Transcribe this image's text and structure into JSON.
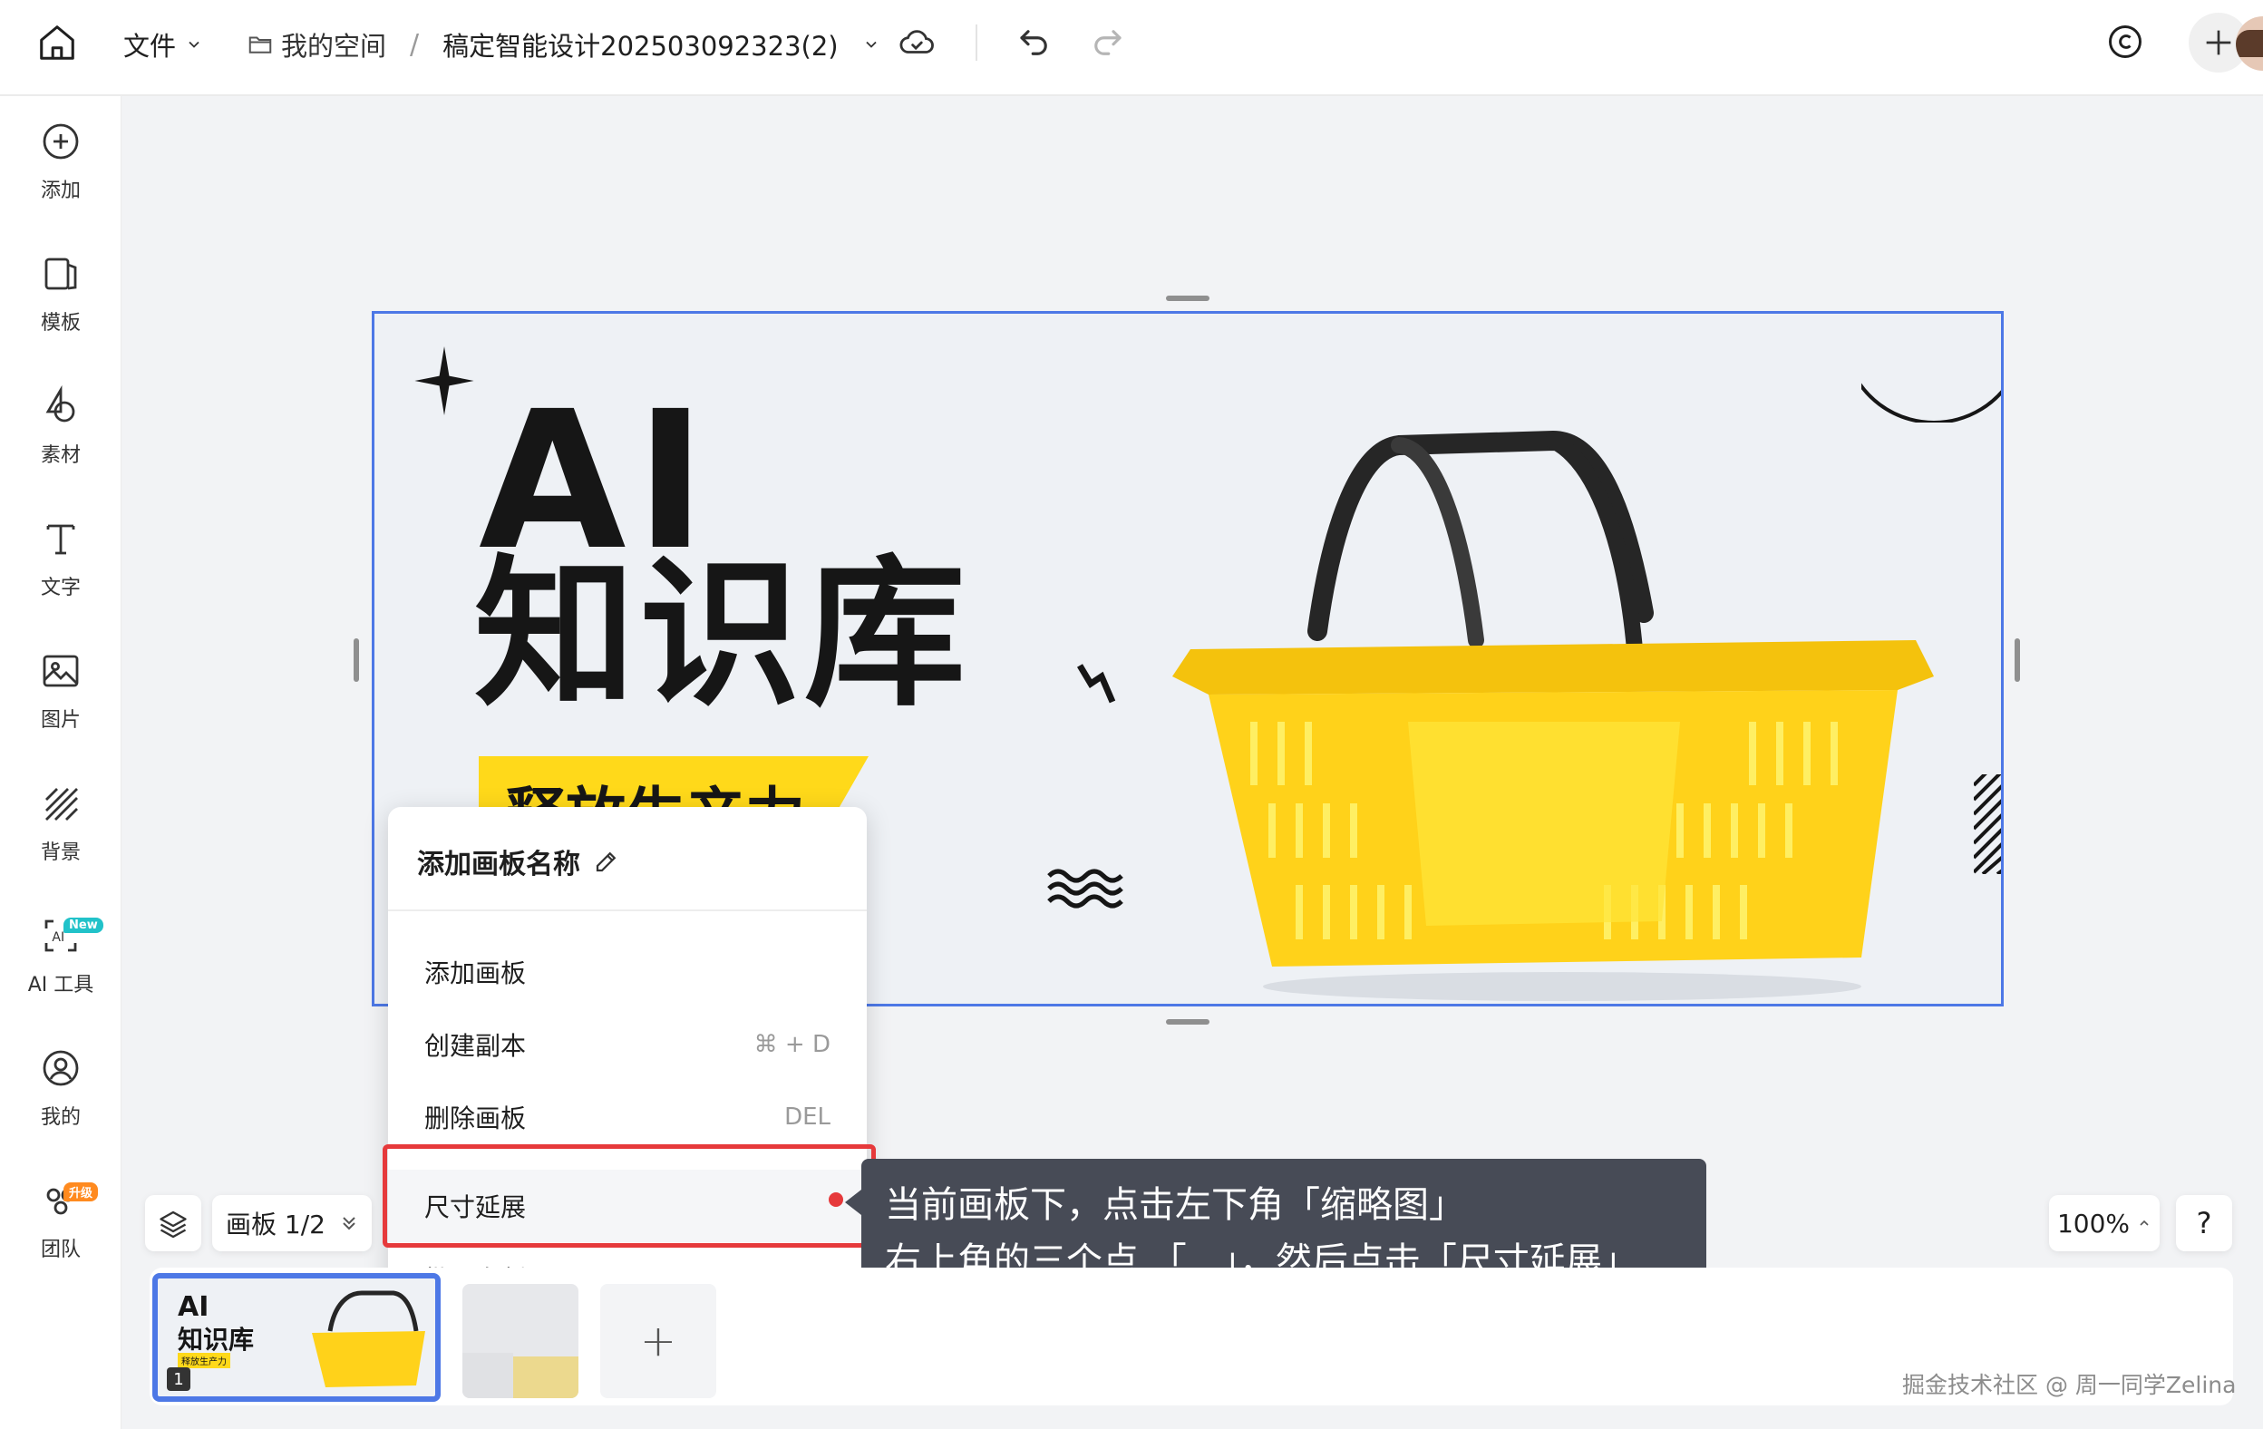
{
  "header": {
    "file_menu_label": "文件",
    "breadcrumb_space": "我的空间",
    "breadcrumb_sep": "/",
    "document_title": "稿定智能设计202503092323(2)"
  },
  "sidebar": {
    "items": [
      {
        "label": "添加"
      },
      {
        "label": "模板"
      },
      {
        "label": "素材"
      },
      {
        "label": "文字"
      },
      {
        "label": "图片"
      },
      {
        "label": "背景"
      },
      {
        "label": "AI 工具",
        "badge": "New"
      },
      {
        "label": "我的"
      },
      {
        "label": "团队",
        "badge": "升级"
      }
    ]
  },
  "artboard": {
    "headline": "AI",
    "subheadline": "知识库",
    "band_text": "释放生产力"
  },
  "context_menu": {
    "title": "添加画板名称",
    "items": [
      {
        "label": "添加画板",
        "shortcut": ""
      },
      {
        "label": "创建副本",
        "shortcut": "⌘ + D"
      },
      {
        "label": "删除画板",
        "shortcut": "DEL"
      },
      {
        "label": "尺寸延展",
        "shortcut": ""
      },
      {
        "label": "批量套版",
        "shortcut": ""
      }
    ]
  },
  "tooltip": {
    "line1": "当前画板下，点击左下角「缩略图」",
    "line2": "右上角的三个点 「...」，然后点击「尺寸延展」"
  },
  "bottom": {
    "board_indicator": "画板 1/2",
    "zoom": "100%",
    "help": "?",
    "add_board_symbol": "+",
    "thumb_index": "1",
    "thumb_title": "AI",
    "thumb_subtitle": "知识库",
    "thumb_band": "释放生产力"
  },
  "watermark": "掘金技术社区 @ 周一同学Zelina",
  "colors": {
    "accent_blue": "#4d78e6",
    "highlight_red": "#e6393b",
    "tooltip_bg": "#474b56",
    "yellow": "#ffd91a",
    "badge_new": "#21c2c9",
    "badge_upgrade": "#ff8a1f"
  }
}
